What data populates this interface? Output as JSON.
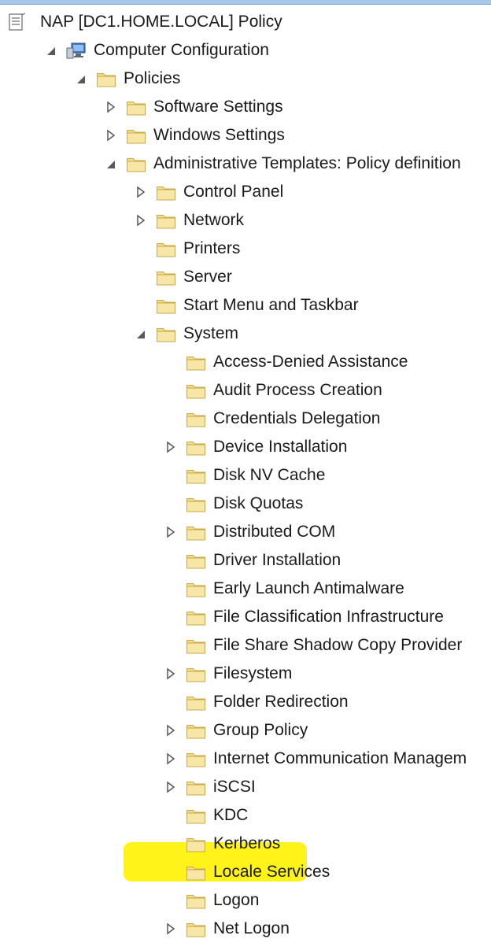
{
  "tree": {
    "items": [
      {
        "label": "NAP [DC1.HOME.LOCAL] Policy",
        "icon": "policy-document-icon",
        "expander": "none"
      },
      {
        "label": "Computer Configuration",
        "icon": "computer-icon",
        "expander": "expanded"
      },
      {
        "label": "Policies",
        "icon": "folder-icon",
        "expander": "expanded"
      },
      {
        "label": "Software Settings",
        "icon": "folder-icon",
        "expander": "collapsed"
      },
      {
        "label": "Windows Settings",
        "icon": "folder-icon",
        "expander": "collapsed"
      },
      {
        "label": "Administrative Templates: Policy definition",
        "icon": "folder-icon",
        "expander": "expanded"
      },
      {
        "label": "Control Panel",
        "icon": "folder-icon",
        "expander": "collapsed"
      },
      {
        "label": "Network",
        "icon": "folder-icon",
        "expander": "collapsed"
      },
      {
        "label": "Printers",
        "icon": "folder-icon",
        "expander": "none"
      },
      {
        "label": "Server",
        "icon": "folder-icon",
        "expander": "none"
      },
      {
        "label": "Start Menu and Taskbar",
        "icon": "folder-icon",
        "expander": "none"
      },
      {
        "label": "System",
        "icon": "folder-icon",
        "expander": "expanded"
      },
      {
        "label": "Access-Denied Assistance",
        "icon": "folder-icon",
        "expander": "none"
      },
      {
        "label": "Audit Process Creation",
        "icon": "folder-icon",
        "expander": "none"
      },
      {
        "label": "Credentials Delegation",
        "icon": "folder-icon",
        "expander": "none"
      },
      {
        "label": "Device Installation",
        "icon": "folder-icon",
        "expander": "collapsed"
      },
      {
        "label": "Disk NV Cache",
        "icon": "folder-icon",
        "expander": "none"
      },
      {
        "label": "Disk Quotas",
        "icon": "folder-icon",
        "expander": "none"
      },
      {
        "label": "Distributed COM",
        "icon": "folder-icon",
        "expander": "collapsed"
      },
      {
        "label": "Driver Installation",
        "icon": "folder-icon",
        "expander": "none"
      },
      {
        "label": "Early Launch Antimalware",
        "icon": "folder-icon",
        "expander": "none"
      },
      {
        "label": "File Classification Infrastructure",
        "icon": "folder-icon",
        "expander": "none"
      },
      {
        "label": "File Share Shadow Copy Provider",
        "icon": "folder-icon",
        "expander": "none"
      },
      {
        "label": "Filesystem",
        "icon": "folder-icon",
        "expander": "collapsed"
      },
      {
        "label": "Folder Redirection",
        "icon": "folder-icon",
        "expander": "none"
      },
      {
        "label": "Group Policy",
        "icon": "folder-icon",
        "expander": "collapsed"
      },
      {
        "label": "Internet Communication Managem",
        "icon": "folder-icon",
        "expander": "collapsed"
      },
      {
        "label": "iSCSI",
        "icon": "folder-icon",
        "expander": "collapsed"
      },
      {
        "label": "KDC",
        "icon": "folder-icon",
        "expander": "none"
      },
      {
        "label": "Kerberos",
        "icon": "folder-icon",
        "expander": "none"
      },
      {
        "label": "Locale Services",
        "icon": "folder-icon",
        "expander": "none"
      },
      {
        "label": "Logon",
        "icon": "folder-icon",
        "expander": "none",
        "highlighted": true
      },
      {
        "label": "Net Logon",
        "icon": "folder-icon",
        "expander": "collapsed"
      }
    ]
  },
  "colors": {
    "highlight": "#fff200",
    "folder_fill": "#f4dc8a",
    "folder_edge": "#c9a94a",
    "expander": "#595959"
  }
}
